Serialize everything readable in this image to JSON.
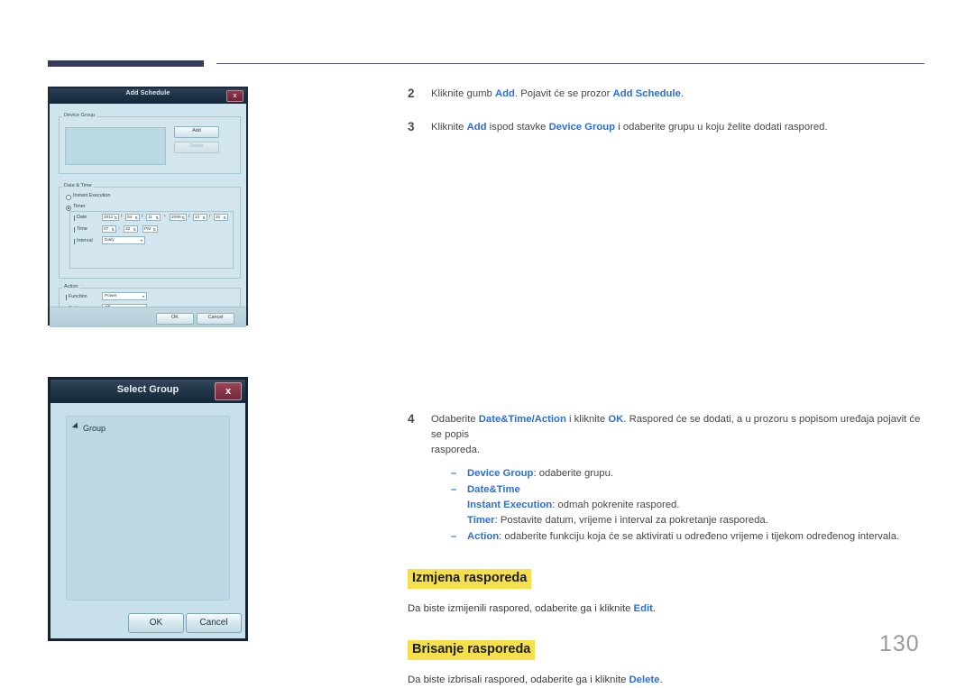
{
  "page": {
    "number": "130"
  },
  "steps": [
    {
      "num": "2",
      "parts": [
        {
          "t": "Kliknite gumb ",
          "bold": false
        },
        {
          "t": "Add",
          "bold": true
        },
        {
          "t": ". Pojavit će se prozor ",
          "bold": false
        },
        {
          "t": "Add Schedule",
          "bold": true
        },
        {
          "t": ".",
          "bold": false
        }
      ]
    },
    {
      "num": "3",
      "parts": [
        {
          "t": "Kliknite ",
          "bold": false
        },
        {
          "t": "Add",
          "bold": true
        },
        {
          "t": " ispod stavke ",
          "bold": false
        },
        {
          "t": "Device Group",
          "bold": true
        },
        {
          "t": " i odaberite grupu u koju želite dodati raspored.",
          "bold": false
        }
      ]
    }
  ],
  "step4": {
    "num": "4",
    "line1_a": "Odaberite ",
    "line1_b": "Date&Time",
    "line1_c": "/",
    "line1_d": "Action",
    "line1_e": " i kliknite ",
    "line1_f": "OK",
    "line1_g": ". Raspored će se dodati, a u prozoru s popisom uređaja pojavit će se popis",
    "line2": "rasporeda.",
    "dash": "–",
    "bullets": [
      {
        "label": "Device Group",
        "text": ": odaberite grupu."
      },
      {
        "label": "Date&Time",
        "text": ""
      },
      {
        "label": "Action",
        "text": ": odaberite funkciju koja će se aktivirati u određeno vrijeme i tijekom određenog intervala."
      }
    ],
    "sub_instant_label": "Instant Execution",
    "sub_instant_text": ": odmah pokrenite raspored.",
    "sub_timer_label": "Timer",
    "sub_timer_text": ": Postavite datum, vrijeme i interval za pokretanje rasporeda."
  },
  "sections": [
    {
      "heading": "Izmjena rasporeda",
      "body_a": "Da biste izmijenili raspored, odaberite ga i kliknite ",
      "body_b": "Edit",
      "body_c": "."
    },
    {
      "heading": "Brisanje rasporeda",
      "body_a": "Da biste izbrisali raspored, odaberite ga i kliknite ",
      "body_b": "Delete",
      "body_c": "."
    }
  ],
  "add_schedule_dialog": {
    "title": "Add Schedule",
    "close": "x",
    "device_group": {
      "legend": "Device Group",
      "add_button": "Add",
      "delete_button": "Delete"
    },
    "date_time": {
      "legend": "Date & Time",
      "instant_execution": "Instant Execution",
      "timer": "Timer",
      "date_label": "Date",
      "time_label": "Time",
      "interval_label": "Interval",
      "date_start_year": "2011",
      "date_start_month": "04",
      "date_start_day": "11",
      "range_dash": "~",
      "date_end_year": "2099",
      "date_end_month": "12",
      "date_end_day": "31",
      "slash": "/",
      "time_hour": "07",
      "time_colon": ":",
      "time_minute": "32",
      "time_meridiem": "PM",
      "interval_value": "Daily"
    },
    "action": {
      "legend": "Action",
      "function_label": "Function",
      "function_value": "Power",
      "setting_label": "Setting",
      "setting_value": "Off"
    },
    "ok_button": "OK",
    "cancel_button": "Cancel"
  },
  "select_group_dialog": {
    "title": "Select Group",
    "close": "x",
    "tree_root": "Group",
    "ok_button": "OK",
    "cancel_button": "Cancel"
  }
}
